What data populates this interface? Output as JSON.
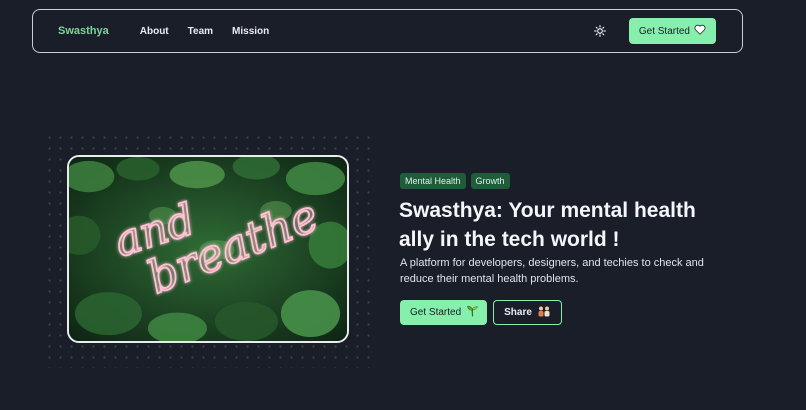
{
  "nav": {
    "brand": "Swasthya",
    "links": [
      {
        "label": "About"
      },
      {
        "label": "Team"
      },
      {
        "label": "Mission"
      }
    ],
    "theme_icon": "sun-icon",
    "cta_label": "Get Started",
    "cta_icon": "heart-icon"
  },
  "hero": {
    "image_alt": "Neon sign reading 'and breathe' on a wall of green plants",
    "image_text_line1": "and",
    "image_text_line2": "breathe",
    "tags": [
      {
        "label": "Mental Health"
      },
      {
        "label": "Growth"
      }
    ],
    "headline_line1": "Swasthya: Your mental health",
    "headline_line2": "ally in the tech world !",
    "subtext": "A platform for developers, designers, and techies to check and reduce their mental health problems.",
    "primary_label": "Get Started",
    "primary_icon": "sprout-icon",
    "secondary_label": "Share",
    "secondary_icon": "people-hugging-icon"
  },
  "colors": {
    "background": "#1a1e29",
    "accent": "#86efac",
    "brand": "#7fd39a",
    "tag_bg": "#1f5c3a"
  }
}
